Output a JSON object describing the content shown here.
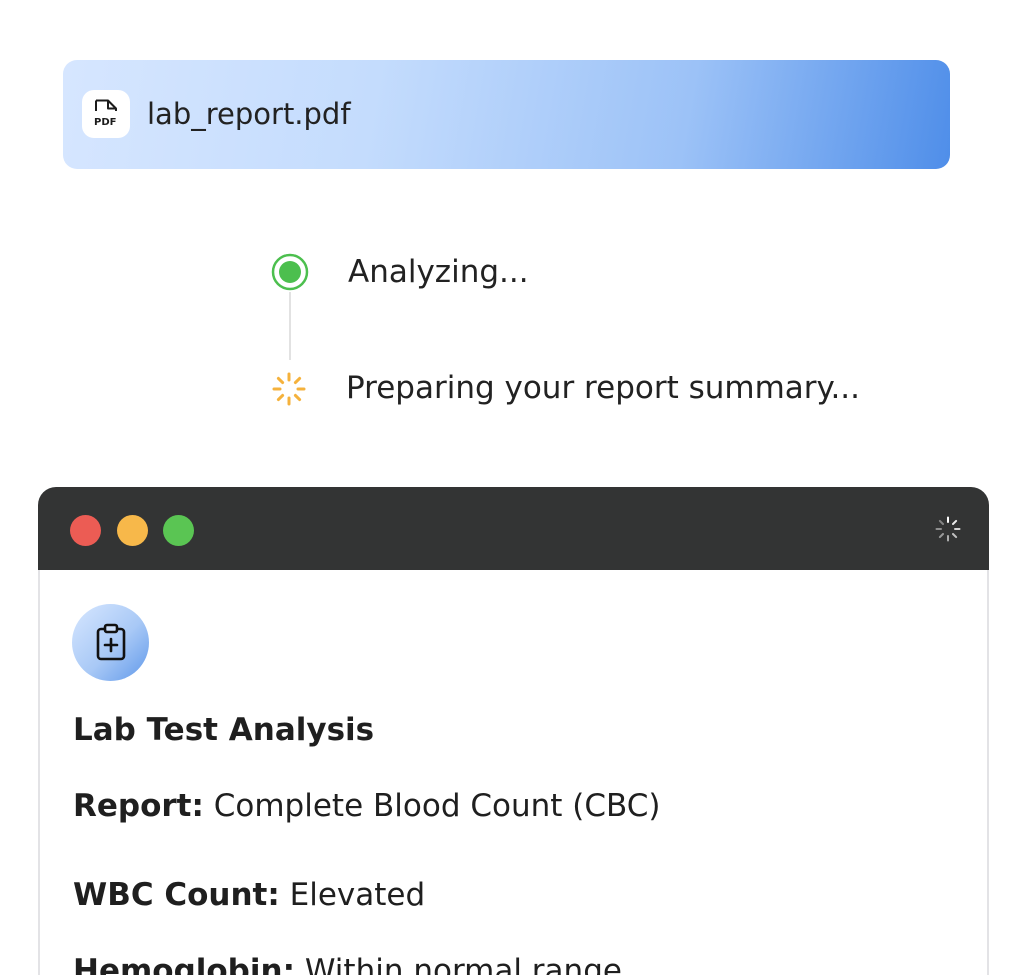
{
  "file": {
    "name": "lab_report.pdf",
    "icon": "pdf-file-icon",
    "icon_label": "PDF"
  },
  "steps": [
    {
      "label": "Analyzing...",
      "status": "active",
      "icon": "status-dot-icon",
      "color": "#4cbf4e"
    },
    {
      "label": "Preparing your report summary...",
      "status": "loading",
      "icon": "spinner-icon",
      "color": "#f5b23c"
    }
  ],
  "window": {
    "traffic_lights": [
      "#ec5c54",
      "#f7b84a",
      "#5ac553"
    ],
    "titlebar_color": "#333434",
    "loading_icon": "spinner-icon",
    "avatar_icon": "clipboard-medical-icon",
    "title": "Lab Test Analysis",
    "rows": [
      {
        "key": "Report:",
        "value": "Complete Blood Count (CBC)"
      },
      {
        "key": "WBC Count:",
        "value": "Elevated"
      },
      {
        "key": "Hemoglobin:",
        "value": "Within normal range"
      }
    ]
  },
  "colors": {
    "accent_blue": "#4f8ee9",
    "active_green": "#4cbf4e",
    "loading_orange": "#f5b23c"
  }
}
